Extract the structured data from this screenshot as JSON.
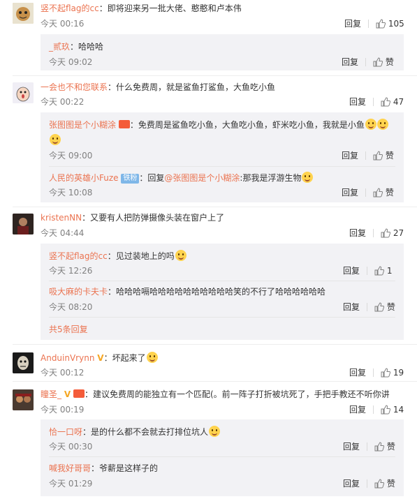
{
  "labels": {
    "reply": "回复",
    "like": "赞",
    "dots": "："
  },
  "comments": [
    {
      "user": "竖不起flag的cc",
      "text": "即将迎来另一批大佬、憨憨和卢本伟",
      "time": "今天 00:16",
      "likes": "105"
    },
    {
      "user": "一会也不和您联系",
      "text": "什么免费周，就是鲨鱼打鲨鱼，大鱼吃小鱼",
      "time": "今天 00:22",
      "likes": "47"
    },
    {
      "user": "kristenNN",
      "text": "又要有人把防弹摄像头装在窗户上了",
      "time": "今天 04:44",
      "likes": "27"
    },
    {
      "user": "AnduinVrynn",
      "text": "坏起来了",
      "time": "今天 00:12",
      "likes": "19"
    },
    {
      "user": "瞳圣_",
      "text": "建议免费周的能独立有一个匹配(。前一阵子打折被坑死了，手把手教还不听你讲",
      "time": "今天 00:19",
      "likes": "14"
    }
  ],
  "replies": {
    "r1": {
      "user": "_贰玖",
      "text": "哈哈哈",
      "time": "今天 09:02",
      "likes": "赞"
    },
    "r2": {
      "user": "张图图是个小糊涂",
      "text": "免费周是鲨鱼吃小鱼，大鱼吃小鱼，虾米吃小鱼，我就是小鱼",
      "time": "今天 09:00",
      "likes": "赞"
    },
    "r3": {
      "user": "人民的英雄小Fuze",
      "fan": "铁粉",
      "prefix": "回复",
      "mention": "@张图图是个小糊涂",
      "text": ":那我是浮游生物",
      "time": "今天 10:08",
      "likes": "赞"
    },
    "r4": {
      "user": "竖不起flag的cc",
      "text": "见过装地上的吗",
      "time": "今天 12:26",
      "likes": "1"
    },
    "r5": {
      "user": "吸大麻的卡夫卡",
      "text": "哈哈哈嗝哈哈哈哈哈哈哈哈哈哈笑的不行了哈哈哈哈哈哈",
      "time": "今天 08:20",
      "likes": "赞"
    },
    "more": "共5条回复",
    "r6": {
      "user": "恰一口呀",
      "text": "是的什么都不会就去打排位坑人",
      "time": "今天 00:30",
      "likes": "赞"
    },
    "r7": {
      "user": "喊我好哥哥",
      "text": "爷薪是这样子的",
      "time": "今天 01:29",
      "likes": "赞"
    }
  }
}
